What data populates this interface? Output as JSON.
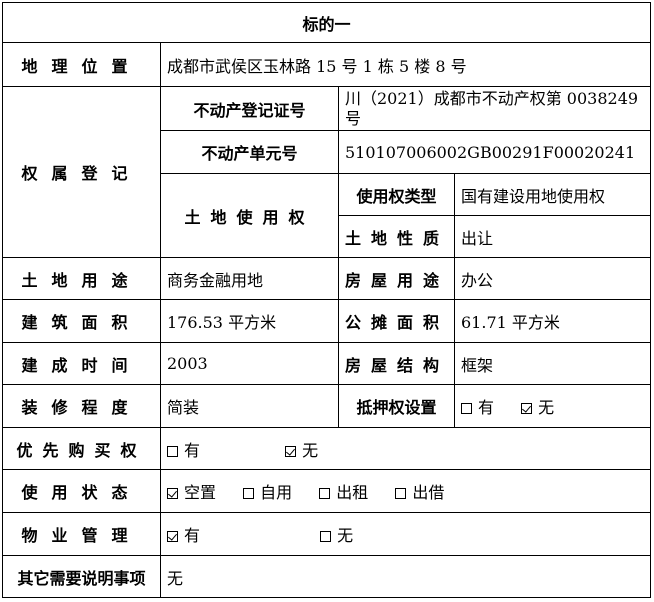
{
  "title": "标的一",
  "location": {
    "label": "地理位置",
    "value": "成都市武侯区玉林路 15 号 1 栋 5 楼 8 号"
  },
  "ownership": {
    "label": "权属登记",
    "cert_label": "不动产登记证号",
    "cert_value": "川（2021）成都市不动产权第 0038249 号",
    "unit_label": "不动产单元号",
    "unit_value": "510107006002GB00291F00020241",
    "land_use_label": "土地使用权",
    "right_type_label": "使用权类型",
    "right_type_value": "国有建设用地使用权",
    "land_nature_label": "土地性质",
    "land_nature_value": "出让"
  },
  "land_purpose": {
    "label": "土地用途",
    "value": "商务金融用地"
  },
  "house_purpose": {
    "label": "房屋用途",
    "value": "办公"
  },
  "area": {
    "label": "建筑面积",
    "value": "176.53 平方米"
  },
  "shared_area": {
    "label": "公摊面积",
    "value": "61.71 平方米"
  },
  "built_time": {
    "label": "建成时间",
    "value": "2003"
  },
  "structure": {
    "label": "房屋结构",
    "value": "框架"
  },
  "decoration": {
    "label": "装修程度",
    "value": "简装"
  },
  "mortgage": {
    "label": "抵押权设置",
    "options": [
      {
        "text": "有",
        "checked": false
      },
      {
        "text": "无",
        "checked": true
      }
    ]
  },
  "preemption": {
    "label": "优先购买权",
    "options": [
      {
        "text": "有",
        "checked": false
      },
      {
        "text": "无",
        "checked": true
      }
    ]
  },
  "usage_status": {
    "label": "使用状态",
    "options": [
      {
        "text": "空置",
        "checked": true
      },
      {
        "text": "自用",
        "checked": false
      },
      {
        "text": "出租",
        "checked": false
      },
      {
        "text": "出借",
        "checked": false
      }
    ]
  },
  "property_mgmt": {
    "label": "物业管理",
    "options": [
      {
        "text": "有",
        "checked": true
      },
      {
        "text": "无",
        "checked": false
      }
    ]
  },
  "other": {
    "label": "其它需要说明事项",
    "value": "无"
  }
}
